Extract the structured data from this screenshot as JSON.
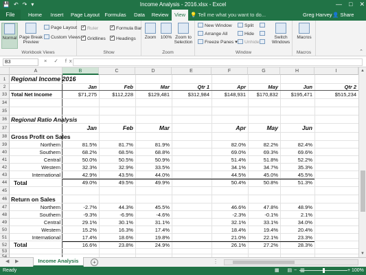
{
  "window": {
    "title": "Income Analysis - 2016.xlsx - Excel",
    "controls": [
      "—",
      "□",
      "✕"
    ]
  },
  "ribbon_tabs": {
    "file": "File",
    "tabs": [
      "Home",
      "Insert",
      "Page Layout",
      "Formulas",
      "Data",
      "Review",
      "View"
    ],
    "active": "View",
    "tell_me": "Tell me what you want to do...",
    "user": "Greg Harvey",
    "share": "Share"
  },
  "ribbon": {
    "workbook_views": {
      "label": "Workbook Views",
      "normal": "Normal",
      "page_break": "Page Break Preview",
      "page_layout": "Page Layout",
      "custom_views": "Custom Views"
    },
    "show": {
      "label": "Show",
      "ruler": "Ruler",
      "formula_bar": "Formula Bar",
      "gridlines": "Gridlines",
      "headings": "Headings"
    },
    "zoom": {
      "label": "Zoom",
      "zoom": "Zoom",
      "hundred": "100%",
      "zoom_selection": "Zoom to Selection"
    },
    "window_group": {
      "label": "Window",
      "new_window": "New Window",
      "arrange_all": "Arrange All",
      "freeze_panes": "Freeze Panes",
      "split": "Split",
      "hide": "Hide",
      "unhide": "Unhide",
      "switch_windows": "Switch Windows"
    },
    "macros": {
      "label": "Macros",
      "macros": "Macros"
    }
  },
  "formula_bar": {
    "name_box": "B3",
    "fx": "× ✓ fx",
    "value": ""
  },
  "columns": [
    "A",
    "B",
    "C",
    "D",
    "E",
    "F",
    "G",
    "H",
    "I"
  ],
  "selected_column": "B",
  "sheet": {
    "row1": {
      "num": "1",
      "title": "Regional Income 2016"
    },
    "row2": {
      "num": "2",
      "headers": [
        "Jan",
        "Feb",
        "Mar",
        "Qtr 1",
        "Apr",
        "May",
        "Jun",
        "Qtr 2"
      ]
    },
    "row33": {
      "num": "33",
      "label": "Total Net Income",
      "values": [
        "$71,275",
        "$112,228",
        "$129,481",
        "$312,984",
        "$148,931",
        "$170,832",
        "$195,471",
        "$515,234"
      ]
    },
    "row34": {
      "num": "34"
    },
    "row35": {
      "num": "35"
    },
    "row36": {
      "num": "36",
      "title": "Regional Ratio Analysis"
    },
    "row37": {
      "num": "37",
      "headers": [
        "Jan",
        "Feb",
        "Mar",
        "Apr",
        "May",
        "Jun"
      ]
    },
    "row38": {
      "num": "38",
      "title": "Gross Profit on Sales"
    },
    "gross": [
      {
        "num": "39",
        "region": "Northern",
        "vals": [
          "81.5%",
          "81.7%",
          "81.9%",
          "82.0%",
          "82.2%",
          "82.4%"
        ]
      },
      {
        "num": "40",
        "region": "Southern",
        "vals": [
          "68.2%",
          "68.5%",
          "68.8%",
          "69.0%",
          "69.3%",
          "69.6%"
        ]
      },
      {
        "num": "41",
        "region": "Central",
        "vals": [
          "50.0%",
          "50.5%",
          "50.9%",
          "51.4%",
          "51.8%",
          "52.2%"
        ]
      },
      {
        "num": "42",
        "region": "Western",
        "vals": [
          "32.3%",
          "32.9%",
          "33.5%",
          "34.1%",
          "34.7%",
          "35.3%"
        ]
      },
      {
        "num": "43",
        "region": "International",
        "vals": [
          "42.9%",
          "43.5%",
          "44.0%",
          "44.5%",
          "45.0%",
          "45.5%"
        ]
      }
    ],
    "gross_total": {
      "num": "44",
      "label": "Total",
      "vals": [
        "49.0%",
        "49.5%",
        "49.9%",
        "50.4%",
        "50.8%",
        "51.3%"
      ]
    },
    "row45": {
      "num": "45"
    },
    "row46": {
      "num": "46",
      "title": "Return on Sales"
    },
    "ret": [
      {
        "num": "47",
        "region": "Northern",
        "vals": [
          "-2.7%",
          "44.3%",
          "45.5%",
          "46.6%",
          "47.8%",
          "48.9%"
        ]
      },
      {
        "num": "48",
        "region": "Southern",
        "vals": [
          "-9.3%",
          "-6.9%",
          "-4.6%",
          "-2.3%",
          "-0.1%",
          "2.1%"
        ]
      },
      {
        "num": "49",
        "region": "Central",
        "vals": [
          "29.1%",
          "30.1%",
          "31.1%",
          "32.1%",
          "33.1%",
          "34.0%"
        ]
      },
      {
        "num": "50",
        "region": "Western",
        "vals": [
          "15.2%",
          "16.3%",
          "17.4%",
          "18.4%",
          "19.4%",
          "20.4%"
        ]
      },
      {
        "num": "51",
        "region": "International",
        "vals": [
          "17.4%",
          "18.6%",
          "19.8%",
          "21.0%",
          "22.1%",
          "23.3%"
        ]
      }
    ],
    "ret_total": {
      "num": "52",
      "label": "Total",
      "vals": [
        "16.6%",
        "23.8%",
        "24.9%",
        "26.1%",
        "27.2%",
        "28.3%"
      ]
    },
    "row53": {
      "num": "53"
    },
    "row54": {
      "num": "54"
    },
    "row55": {
      "num": "55"
    }
  },
  "sheet_tabs": {
    "active": "Income Analysis",
    "add": "+",
    "nav_prev": "◀",
    "nav_next": "▶",
    "more": "⋮"
  },
  "status_bar": {
    "ready": "Ready",
    "zoom": "100%",
    "view_icons": "▦ ▤ ▥",
    "zoom_minus": "−",
    "zoom_plus": "+"
  },
  "icons": {
    "save": "💾",
    "undo": "↶",
    "redo": "↷",
    "more": "▾"
  }
}
